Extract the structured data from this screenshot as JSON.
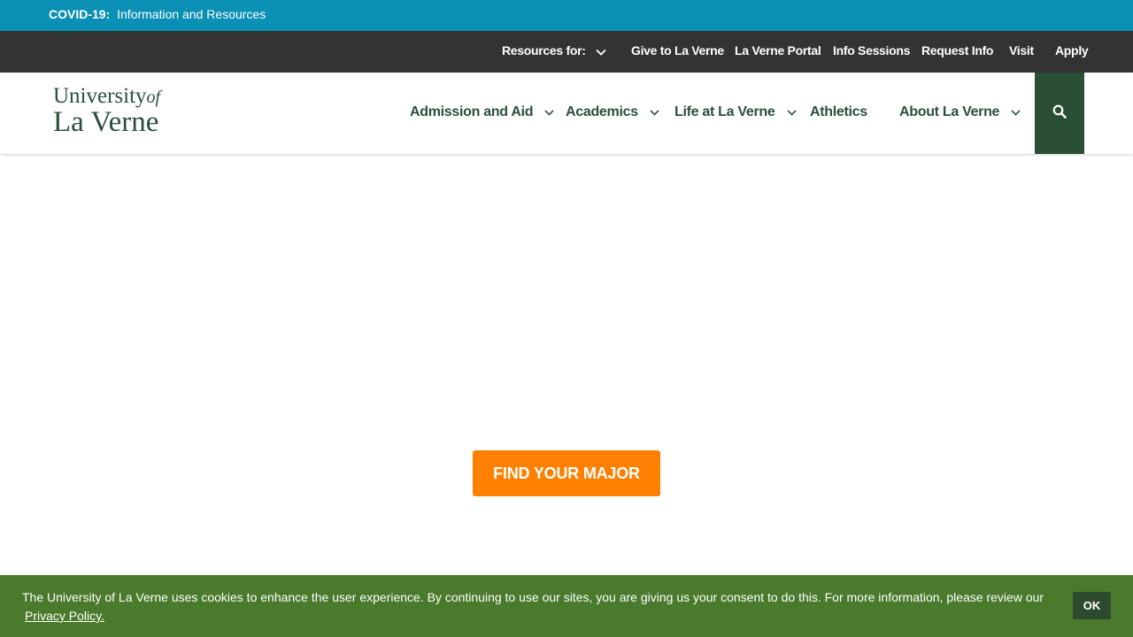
{
  "covid": {
    "label": "COVID-19:",
    "text": "Information and Resources"
  },
  "utility_nav": {
    "resources_label": "Resources for:",
    "items": [
      "Give to La Verne",
      "La Verne Portal",
      "Info Sessions",
      "Request Info",
      "Visit",
      "Apply"
    ]
  },
  "logo": {
    "line1": "University",
    "line1_suffix": "of",
    "line2": "La Verne"
  },
  "main_nav": {
    "items": [
      "Admission and Aid",
      "Academics",
      "Life at La Verne",
      "Athletics",
      "About La Verne"
    ]
  },
  "cta": {
    "label": "FIND YOUR MAJOR"
  },
  "cookie": {
    "text": "The University of La Verne uses cookies to enhance the user experience. By continuing to use our sites, you are giving us your consent to do this. For more information, please review our",
    "link": "Privacy Policy.",
    "ok": "OK"
  },
  "colors": {
    "covid_bar": "#0a8fb5",
    "utility_bar": "#333333",
    "brand_green": "#2b4f3a",
    "cta_orange": "#ff7f00",
    "cookie_bar": "#4a7a2c"
  },
  "icons": {
    "dropdown": "chevron-down-icon",
    "search": "search-icon"
  }
}
